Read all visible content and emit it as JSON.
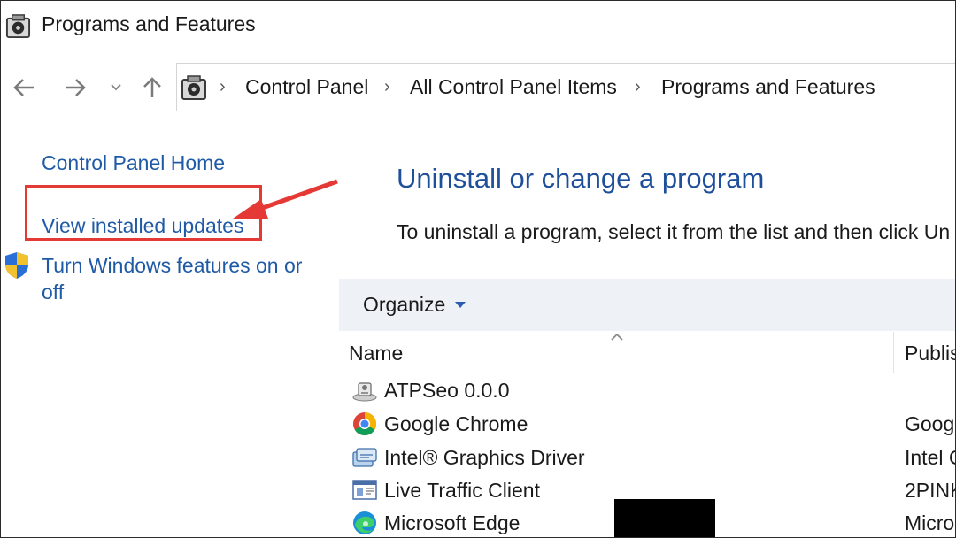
{
  "window": {
    "title": "Programs and Features"
  },
  "breadcrumb": [
    "Control Panel",
    "All Control Panel Items",
    "Programs and Features"
  ],
  "sidebar": {
    "home": "Control Panel Home",
    "updates": "View installed updates",
    "features_line1": "Turn Windows features on or",
    "features_line2": "off"
  },
  "main": {
    "heading": "Uninstall or change a program",
    "description": "To uninstall a program, select it from the list and then click Un"
  },
  "toolbar": {
    "organize": "Organize"
  },
  "columns": {
    "name": "Name",
    "publisher": "Publis"
  },
  "programs": [
    {
      "name": "ATPSeo 0.0.0",
      "publisher": "",
      "icon": "installer-icon"
    },
    {
      "name": "Google Chrome",
      "publisher": "Goog",
      "icon": "chrome-icon"
    },
    {
      "name": "Intel® Graphics Driver",
      "publisher": "Intel C",
      "icon": "intel-graphics-icon"
    },
    {
      "name": "Live Traffic Client",
      "publisher": "2PINK",
      "icon": "window-app-icon"
    },
    {
      "name": "Microsoft Edge",
      "publisher": "Micro",
      "icon": "edge-icon"
    }
  ],
  "colors": {
    "link": "#1f5aa6",
    "heading": "#1e4f9a",
    "highlight": "#e53935",
    "toolbar_bg": "#eef2f7"
  }
}
